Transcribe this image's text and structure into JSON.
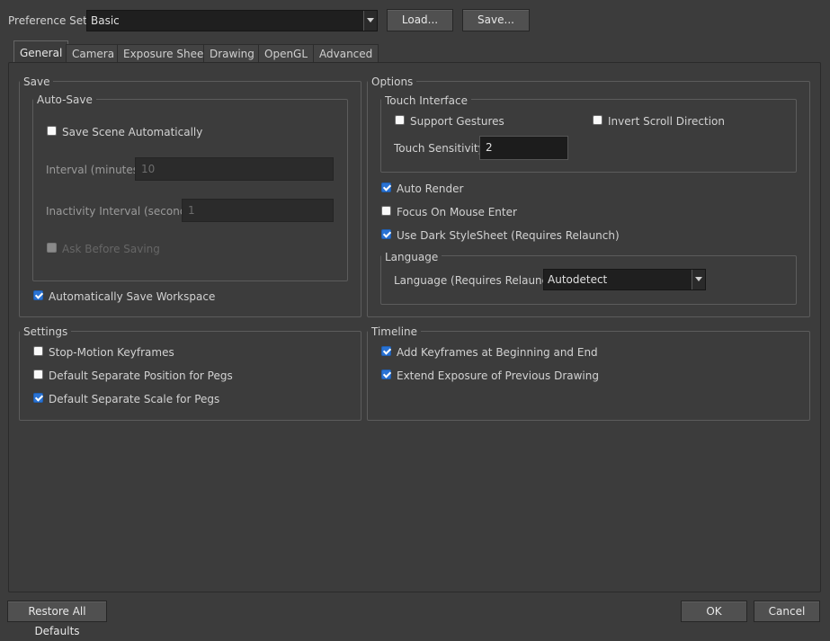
{
  "header": {
    "preference_set_label": "Preference Set:",
    "preference_set_value": "Basic",
    "load_label": "Load...",
    "save_label": "Save..."
  },
  "tabs": [
    {
      "label": "General",
      "active": true
    },
    {
      "label": "Camera"
    },
    {
      "label": "Exposure Sheet"
    },
    {
      "label": "Drawing"
    },
    {
      "label": "OpenGL"
    },
    {
      "label": "Advanced"
    }
  ],
  "save_group": {
    "title": "Save",
    "autosave": {
      "title": "Auto-Save",
      "save_scene_label": "Save Scene Automatically",
      "save_scene_checked": false,
      "interval_label": "Interval (minutes)",
      "interval_value": "10",
      "inactivity_label": "Inactivity Interval (seconds)",
      "inactivity_value": "1",
      "ask_before_label": "Ask Before Saving",
      "ask_before_checked": false
    },
    "auto_workspace_label": "Automatically Save Workspace",
    "auto_workspace_checked": true
  },
  "options_group": {
    "title": "Options",
    "touch": {
      "title": "Touch Interface",
      "support_gestures_label": "Support Gestures",
      "support_gestures_checked": false,
      "invert_scroll_label": "Invert Scroll Direction",
      "invert_scroll_checked": false,
      "sensitivity_label": "Touch Sensitivity",
      "sensitivity_value": "2"
    },
    "auto_render_label": "Auto Render",
    "auto_render_checked": true,
    "focus_mouse_label": "Focus On Mouse Enter",
    "focus_mouse_checked": false,
    "dark_style_label": "Use Dark StyleSheet (Requires Relaunch)",
    "dark_style_checked": true,
    "language": {
      "title": "Language",
      "label": "Language (Requires Relaunch)",
      "value": "Autodetect"
    }
  },
  "settings_group": {
    "title": "Settings",
    "stop_motion_label": "Stop-Motion Keyframes",
    "stop_motion_checked": false,
    "sep_position_label": "Default Separate Position for Pegs",
    "sep_position_checked": false,
    "sep_scale_label": "Default Separate Scale for Pegs",
    "sep_scale_checked": true
  },
  "timeline_group": {
    "title": "Timeline",
    "add_keyframes_label": "Add Keyframes at Beginning and End",
    "add_keyframes_checked": true,
    "extend_exposure_label": "Extend Exposure of Previous Drawing",
    "extend_exposure_checked": true
  },
  "footer": {
    "restore_label": "Restore All Defaults",
    "ok_label": "OK",
    "cancel_label": "Cancel"
  }
}
